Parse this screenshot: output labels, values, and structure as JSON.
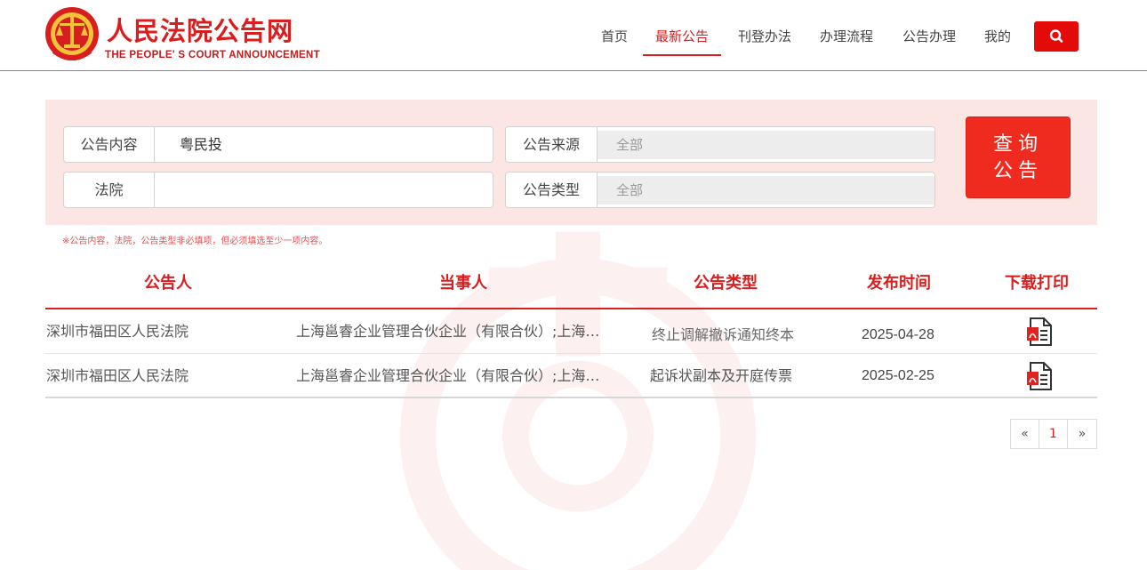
{
  "site": {
    "title": "人民法院公告网",
    "subtitle": "THE PEOPLE' S COURT ANNOUNCEMENT",
    "logo_icon": "court-emblem-icon",
    "brand_color": "#d81e1e"
  },
  "nav": {
    "items": [
      {
        "label": "首页",
        "active": false
      },
      {
        "label": "最新公告",
        "active": true
      },
      {
        "label": "刊登办法",
        "active": false
      },
      {
        "label": "办理流程",
        "active": false
      },
      {
        "label": "公告办理",
        "active": false
      },
      {
        "label": "我的",
        "active": false
      }
    ],
    "search_icon": "search-icon"
  },
  "search": {
    "content_label": "公告内容",
    "content_value": "粤民投",
    "court_label": "法院",
    "court_value": "",
    "source_label": "公告来源",
    "source_value": "全部",
    "type_label": "公告类型",
    "type_value": "全部",
    "button_line1": "查询",
    "button_line2": "公告",
    "note": "※公告内容，法院，公告类型非必填项，但必须填选至少一项内容。"
  },
  "table": {
    "headers": [
      "公告人",
      "当事人",
      "公告类型",
      "发布时间",
      "下载打印"
    ],
    "rows": [
      {
        "announcer": "深圳市福田区人民法院",
        "party": "上海邕睿企业管理合伙企业（有限合伙）;上海…",
        "type": "终止调解撤诉通知终本",
        "date": "2025-04-28",
        "download_icon": "pdf-icon"
      },
      {
        "announcer": "深圳市福田区人民法院",
        "party": "上海邕睿企业管理合伙企业（有限合伙）;上海…",
        "type": "起诉状副本及开庭传票",
        "date": "2025-02-25",
        "download_icon": "pdf-icon"
      }
    ]
  },
  "pagination": {
    "prev": "«",
    "current": "1",
    "next": "»"
  }
}
